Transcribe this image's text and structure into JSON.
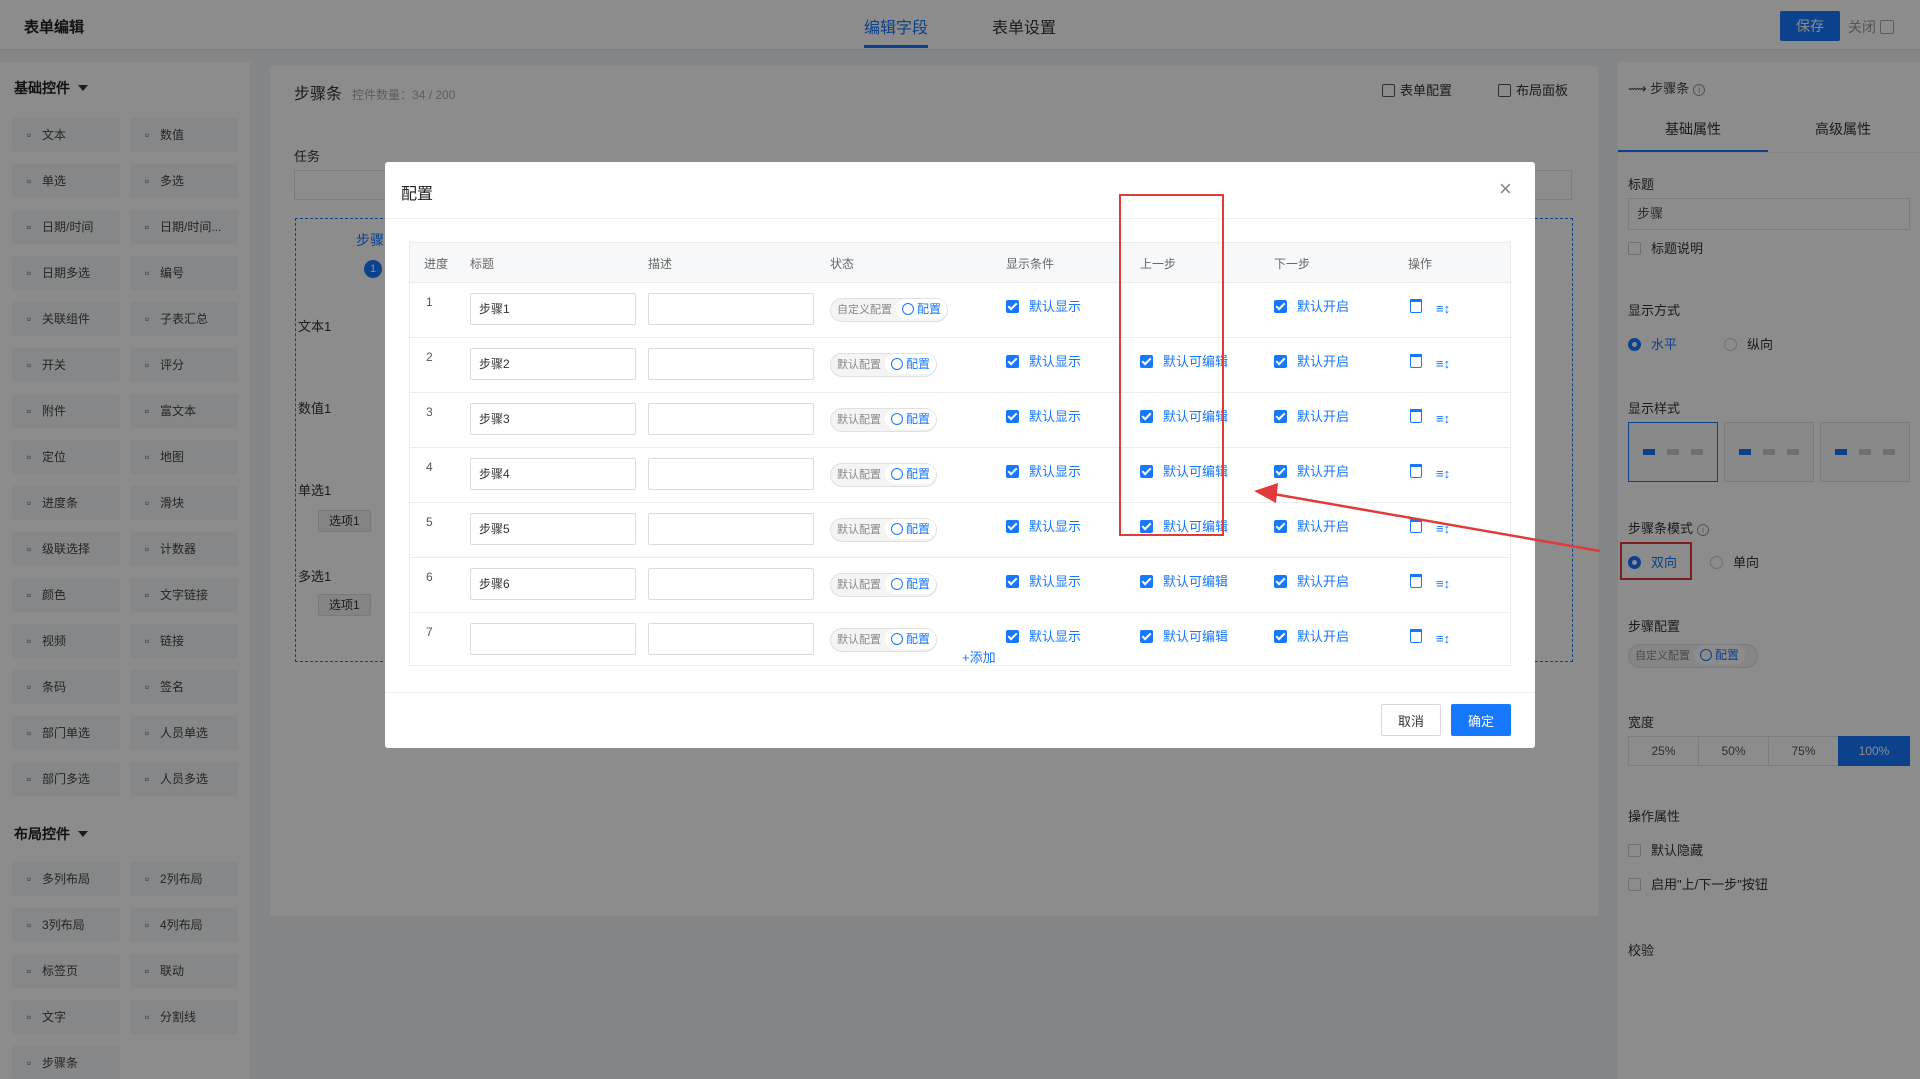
{
  "app_title": "表单编辑",
  "top_tabs": [
    "编辑字段",
    "表单设置"
  ],
  "save_label": "保存",
  "close_label": "关闭",
  "left": {
    "basic_title": "基础控件",
    "basic_items": [
      {
        "label": "文本",
        "icon": "text-icon"
      },
      {
        "label": "数值",
        "icon": "number-icon"
      },
      {
        "label": "单选",
        "icon": "radio-icon"
      },
      {
        "label": "多选",
        "icon": "checkbox-icon"
      },
      {
        "label": "日期/时间",
        "icon": "clock-icon"
      },
      {
        "label": "日期/时间...",
        "icon": "calendar-icon"
      },
      {
        "label": "日期多选",
        "icon": "calendar-multi-icon"
      },
      {
        "label": "编号",
        "icon": "serial-icon"
      },
      {
        "label": "关联组件",
        "icon": "link-component-icon"
      },
      {
        "label": "子表汇总",
        "icon": "sigma-icon"
      },
      {
        "label": "开关",
        "icon": "switch-icon"
      },
      {
        "label": "评分",
        "icon": "star-icon"
      },
      {
        "label": "附件",
        "icon": "paperclip-icon"
      },
      {
        "label": "富文本",
        "icon": "richtext-icon"
      },
      {
        "label": "定位",
        "icon": "location-icon"
      },
      {
        "label": "地图",
        "icon": "map-icon"
      },
      {
        "label": "进度条",
        "icon": "progress-icon"
      },
      {
        "label": "滑块",
        "icon": "slider-icon"
      },
      {
        "label": "级联选择",
        "icon": "cascade-icon"
      },
      {
        "label": "计数器",
        "icon": "counter-icon"
      },
      {
        "label": "颜色",
        "icon": "color-picker-icon"
      },
      {
        "label": "文字链接",
        "icon": "globe-icon"
      },
      {
        "label": "视频",
        "icon": "video-icon"
      },
      {
        "label": "链接",
        "icon": "globe-link-icon"
      },
      {
        "label": "条码",
        "icon": "barcode-icon"
      },
      {
        "label": "签名",
        "icon": "signature-icon"
      },
      {
        "label": "部门单选",
        "icon": "dept-single-icon"
      },
      {
        "label": "人员单选",
        "icon": "user-icon"
      },
      {
        "label": "部门多选",
        "icon": "dept-multi-icon"
      },
      {
        "label": "人员多选",
        "icon": "users-icon"
      }
    ],
    "layout_title": "布局控件",
    "layout_items": [
      {
        "label": "多列布局",
        "icon": "multi-col-icon"
      },
      {
        "label": "2列布局",
        "icon": "two-col-icon"
      },
      {
        "label": "3列布局",
        "icon": "three-col-icon"
      },
      {
        "label": "4列布局",
        "icon": "four-col-icon"
      },
      {
        "label": "标签页",
        "icon": "tabs-icon"
      },
      {
        "label": "联动",
        "icon": "linkage-icon"
      },
      {
        "label": "文字",
        "icon": "text-t-icon"
      },
      {
        "label": "分割线",
        "icon": "divider-icon"
      },
      {
        "label": "步骤条",
        "icon": "steps-icon"
      }
    ]
  },
  "center": {
    "title": "步骤条",
    "count": "控件数量：34 / 200",
    "tool_form_config": "表单配置",
    "tool_layout_panel": "布局面板",
    "task_label": "任务",
    "step_label": "步骤",
    "step_num": "1",
    "text1_label": "文本1",
    "num1_label": "数值1",
    "single1_label": "单选1",
    "single_option": "选项1",
    "multi1_label": "多选1",
    "multi_option": "选项1"
  },
  "right": {
    "header": "步骤条",
    "tabs": [
      "基础属性",
      "高级属性"
    ],
    "title_label": "标题",
    "title_value": "步骤",
    "title_desc": "标题说明",
    "display_mode_label": "显示方式",
    "mode_options": [
      "水平",
      "纵向"
    ],
    "display_style_label": "显示样式",
    "step_mode_label": "步骤条模式",
    "step_mode_options": [
      "双向",
      "单向"
    ],
    "step_config_label": "步骤配置",
    "step_config_status": "自定义配置",
    "step_config_btn": "配置",
    "width_label": "宽度",
    "width_options": [
      "25%",
      "50%",
      "75%",
      "100%"
    ],
    "op_label": "操作属性",
    "op_hidden": "默认隐藏",
    "op_buttons": "启用\"上/下一步\"按钮",
    "validate_label": "校验"
  },
  "modal": {
    "title": "配置",
    "headers": [
      "进度",
      "标题",
      "描述",
      "状态",
      "显示条件",
      "上一步",
      "下一步",
      "操作"
    ],
    "config_btn": "配置",
    "rows": [
      {
        "idx": "1",
        "title": "步骤1",
        "status": "自定义配置",
        "show": "默认显示",
        "prev": "",
        "next": "默认开启"
      },
      {
        "idx": "2",
        "title": "步骤2",
        "status": "默认配置",
        "show": "默认显示",
        "prev": "默认可编辑",
        "next": "默认开启"
      },
      {
        "idx": "3",
        "title": "步骤3",
        "status": "默认配置",
        "show": "默认显示",
        "prev": "默认可编辑",
        "next": "默认开启"
      },
      {
        "idx": "4",
        "title": "步骤4",
        "status": "默认配置",
        "show": "默认显示",
        "prev": "默认可编辑",
        "next": "默认开启"
      },
      {
        "idx": "5",
        "title": "步骤5",
        "status": "默认配置",
        "show": "默认显示",
        "prev": "默认可编辑",
        "next": "默认开启"
      },
      {
        "idx": "6",
        "title": "步骤6",
        "status": "默认配置",
        "show": "默认显示",
        "prev": "默认可编辑",
        "next": "默认开启"
      },
      {
        "idx": "7",
        "title": "",
        "status": "默认配置",
        "show": "默认显示",
        "prev": "默认可编辑",
        "next": "默认开启"
      }
    ],
    "add_label": "+添加",
    "cancel_label": "取消",
    "ok_label": "确定"
  },
  "colors": {
    "accent": "#1677ff",
    "highlight": "#e03a3a"
  }
}
